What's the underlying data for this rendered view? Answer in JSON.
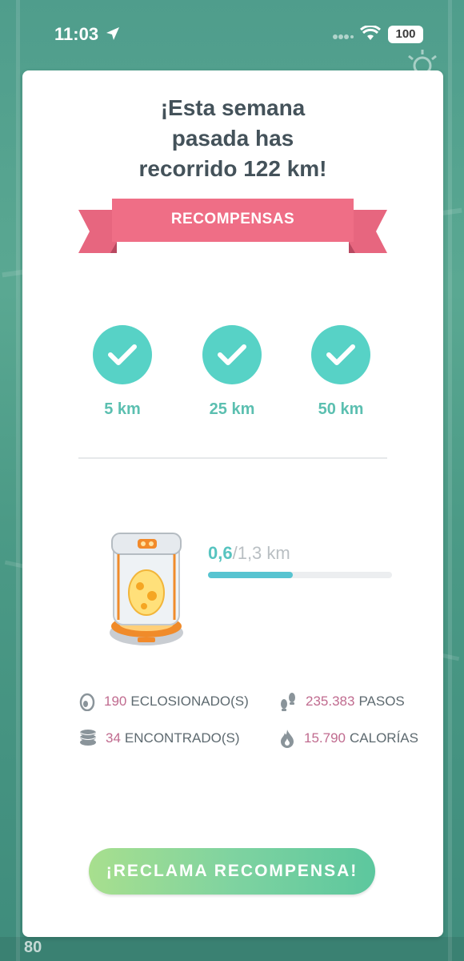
{
  "status_bar": {
    "time": "11:03",
    "battery": "100"
  },
  "dialog": {
    "title_lines": [
      "¡Esta semana",
      "pasada has",
      "recorrido 122 km!"
    ],
    "ribbon_label": "RECOMPENSAS",
    "milestones": [
      {
        "label": "5 km",
        "completed": true
      },
      {
        "label": "25 km",
        "completed": true
      },
      {
        "label": "50 km",
        "completed": true
      }
    ],
    "egg_progress": {
      "current": "0,6",
      "separator_total": "/1,3 km",
      "fraction": 0.46
    },
    "stats": {
      "hatched": {
        "value": "190",
        "label": "ECLOSIONADO(S)",
        "icon": "egg-icon"
      },
      "steps": {
        "value": "235.383",
        "label": "PASOS",
        "icon": "footprints-icon"
      },
      "caught": {
        "value": "34",
        "label": "ENCONTRADO(S)",
        "icon": "coins-stack-icon"
      },
      "calories": {
        "value": "15.790",
        "label": "CALORÍAS",
        "icon": "flame-icon"
      }
    },
    "claim_button": "¡RECLAMA RECOMPENSA!"
  },
  "background": {
    "bottom_number": "80"
  },
  "colors": {
    "accent_teal": "#57d2c6",
    "ribbon_pink": "#e7667f",
    "stat_number": "#c06b8f"
  }
}
